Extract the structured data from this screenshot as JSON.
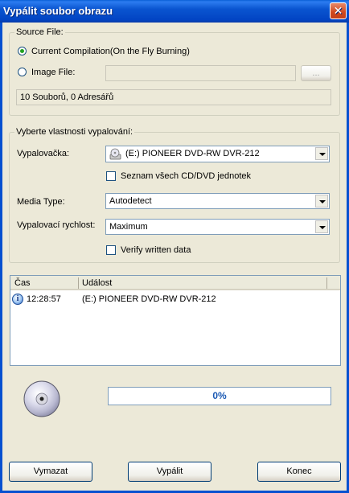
{
  "window": {
    "title": "Vypálit soubor obrazu",
    "close_icon": "close-icon"
  },
  "source": {
    "group_label": "Source File:",
    "option_compilation": "Current Compilation(On the Fly Burning)",
    "option_image": "Image File:",
    "image_path": "",
    "browse_label": "...",
    "summary": "10 Souborů, 0 Adresářů"
  },
  "burn": {
    "group_label": "Vyberte vlastnosti vypalování:",
    "drive_label": "Vypalovačka:",
    "drive_value": "(E:) PIONEER DVD-RW  DVR-212",
    "drive_icon": "cd-drive-icon",
    "list_all_label": "Seznam všech CD/DVD jednotek",
    "media_type_label": "Media Type:",
    "media_type_value": "Autodetect",
    "speed_label": "Vypalovací rychlost:",
    "speed_value": "Maximum",
    "verify_label": "Verify written data"
  },
  "log": {
    "columns": [
      "Čas",
      "Událost"
    ],
    "rows": [
      {
        "icon": "info-icon",
        "time": "12:28:57",
        "event": "(E:) PIONEER DVD-RW  DVR-212"
      }
    ]
  },
  "progress": {
    "percent": 0,
    "label": "0%",
    "disc_icon": "cd-disc-icon"
  },
  "buttons": {
    "clear": "Vymazat",
    "burn": "Vypálit",
    "close": "Konec"
  }
}
